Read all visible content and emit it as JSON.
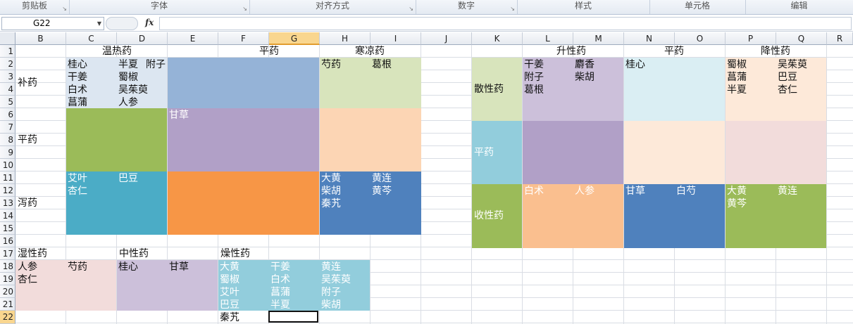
{
  "ribbon": {
    "groups": [
      "剪贴板",
      "字体",
      "对齐方式",
      "数字",
      "样式",
      "单元格",
      "编辑"
    ]
  },
  "formula_bar": {
    "name_box": "G22",
    "fx_label": "fx",
    "formula": ""
  },
  "columns": [
    "B",
    "C",
    "D",
    "E",
    "F",
    "G",
    "H",
    "I",
    "J",
    "K",
    "L",
    "M",
    "N",
    "O",
    "P",
    "Q",
    "R"
  ],
  "selected_column": "G",
  "rows": [
    "1",
    "2",
    "3",
    "4",
    "5",
    "6",
    "7",
    "8",
    "9",
    "10",
    "11",
    "12",
    "13",
    "14",
    "15",
    "16",
    "17",
    "18",
    "19",
    "20",
    "21",
    "22"
  ],
  "selected_row": "22",
  "table1": {
    "col_headers": [
      "温热药",
      "平药",
      "寒凉药"
    ],
    "row_headers": [
      "补药",
      "平药",
      "泻药"
    ],
    "cells": {
      "warm_tonic": [
        "桂心",
        "半夏",
        "附子",
        "干姜",
        "蜀椒",
        "白术",
        "吴茱萸",
        "菖蒲",
        "人参"
      ],
      "neutral_neutral": [
        "甘草"
      ],
      "cold_tonic": [
        "芍药",
        "葛根"
      ],
      "warm_purge": [
        "艾叶",
        "巴豆",
        "杏仁"
      ],
      "cold_purge": [
        "大黄",
        "黄连",
        "柴胡",
        "黄芩",
        "秦艽"
      ]
    },
    "colors": {
      "warm_tonic": "#dce6f1",
      "neutral_tonic": "#95b3d7",
      "cold_tonic": "#d8e4bc",
      "warm_neutral": "#9bbb59",
      "neutral_neutral": "#b1a0c7",
      "cold_neutral": "#fcd5b4",
      "warm_purge": "#4bacc6",
      "neutral_purge": "#f79646",
      "cold_purge": "#4f81bd"
    }
  },
  "table2": {
    "col_headers": [
      "升性药",
      "平药",
      "降性药"
    ],
    "row_headers": [
      "散性药",
      "平药",
      "收性药"
    ],
    "cells": {
      "rise_disperse": [
        "干姜",
        "麝香",
        "附子",
        "柴胡",
        "葛根"
      ],
      "neutral_disperse": [
        "桂心"
      ],
      "descend_disperse": [
        "蜀椒",
        "吴茱萸",
        "菖蒲",
        "巴豆",
        "半夏",
        "杏仁"
      ],
      "rise_astringe": [
        "白术",
        "人参"
      ],
      "neutral_astringe": [
        "甘草",
        "白芍"
      ],
      "descend_astringe": [
        "大黄",
        "黄连",
        "黄芩"
      ]
    },
    "colors": {
      "rowhdr_disperse": "#d8e4bc",
      "rowhdr_neutral": "#92cddc",
      "rowhdr_astringe": "#9bbb59",
      "rise_disperse": "#ccc0da",
      "neutral_disperse": "#daeef3",
      "descend_disperse": "#fde9d9",
      "rise_neutral": "#b1a0c7",
      "neutral_neutral": "#fde9d9",
      "descend_neutral": "#f2dcdb",
      "rise_astringe": "#fabf8f",
      "neutral_astringe": "#4f81bd",
      "descend_astringe": "#9bbb59"
    }
  },
  "table3": {
    "headers": [
      "湿性药",
      "中性药",
      "燥性药"
    ],
    "damp": [
      "人参",
      "芍药",
      "杏仁"
    ],
    "neutral": [
      "桂心",
      "甘草"
    ],
    "dry": [
      "大黄",
      "干姜",
      "黄连",
      "蜀椒",
      "白术",
      "吴茱萸",
      "艾叶",
      "菖蒲",
      "附子",
      "巴豆",
      "半夏",
      "柴胡",
      "秦艽"
    ],
    "colors": {
      "damp": "#f2dcdb",
      "neutral": "#ccc0da",
      "dry": "#92cddc"
    }
  }
}
